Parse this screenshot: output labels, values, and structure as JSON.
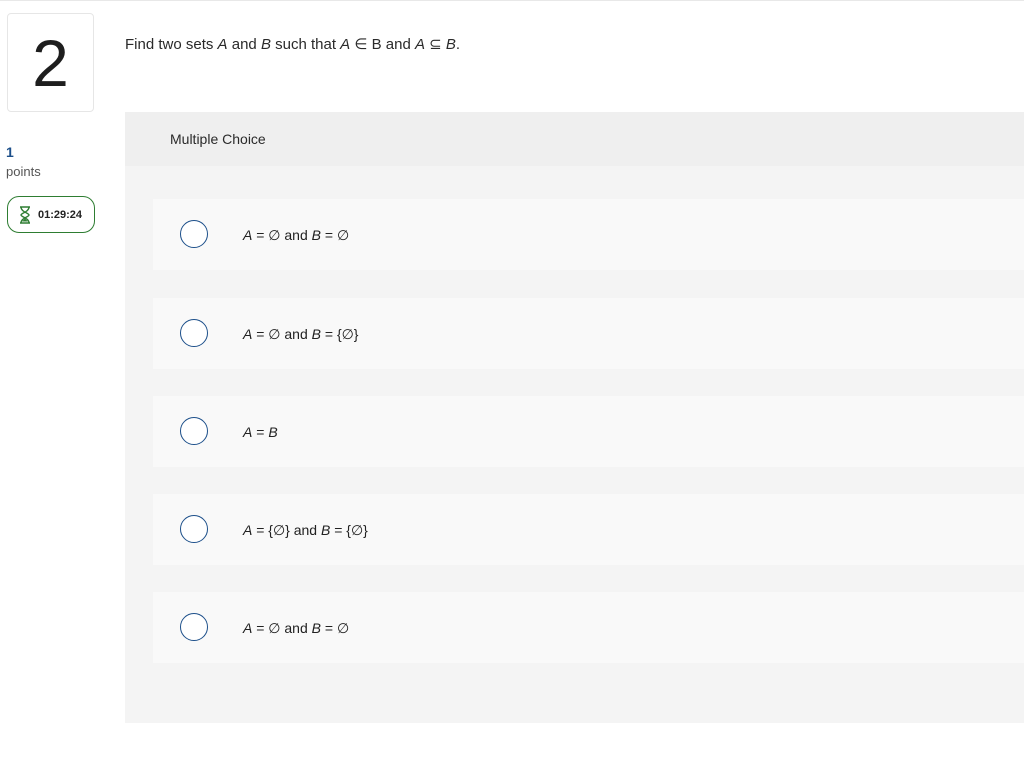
{
  "question_number": "2",
  "points": {
    "value": "1",
    "label": "points"
  },
  "timer": {
    "icon": "hourglass-icon",
    "time": "01:29:24",
    "color": "#2e7d32"
  },
  "question": {
    "text_parts": [
      "Find two sets ",
      "A",
      " and ",
      "B",
      " such that ",
      "A",
      " ∈ B and ",
      "A",
      " ⊆ ",
      "B",
      "."
    ]
  },
  "answer_section": {
    "type_label": "Multiple Choice",
    "options": [
      {
        "parts": [
          "A",
          " = ∅ and ",
          "B",
          " = ∅"
        ]
      },
      {
        "parts": [
          "A",
          " = ∅ and ",
          "B",
          " = {∅}"
        ]
      },
      {
        "parts": [
          "A",
          " = ",
          "B",
          ""
        ]
      },
      {
        "parts": [
          "A",
          " = {∅} and ",
          "B",
          " = {∅}"
        ]
      },
      {
        "parts": [
          "A",
          " = ∅ and ",
          "B",
          " = ∅"
        ]
      }
    ]
  },
  "colors": {
    "accent": "#1c4f8a",
    "panel_bg": "#f4f4f4",
    "option_bg": "#f9f9f9"
  }
}
